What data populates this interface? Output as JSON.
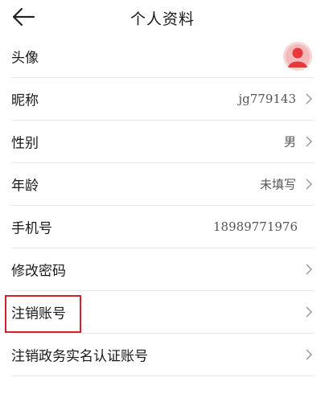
{
  "header": {
    "title": "个人资料",
    "back_icon": "arrow-left-icon"
  },
  "rows": [
    {
      "label": "头像",
      "value": "",
      "avatar_icon": "user-avatar-icon",
      "chevron": false
    },
    {
      "label": "昵称",
      "value": "jg779143",
      "chevron": true
    },
    {
      "label": "性别",
      "value": "男",
      "chevron": true
    },
    {
      "label": "年龄",
      "value": "未填写",
      "chevron": true
    },
    {
      "label": "手机号",
      "value": "18989771976",
      "chevron": false
    },
    {
      "label": "修改密码",
      "value": "",
      "chevron": true
    },
    {
      "label": "注销账号",
      "value": "",
      "chevron": true,
      "highlighted": true
    },
    {
      "label": "注销政务实名认证账号",
      "value": "",
      "chevron": true
    }
  ],
  "colors": {
    "highlight_border": "#d1212c",
    "avatar_accent": "#e8383d",
    "divider": "#e6e6e6",
    "chevron": "#9a9a9a"
  }
}
